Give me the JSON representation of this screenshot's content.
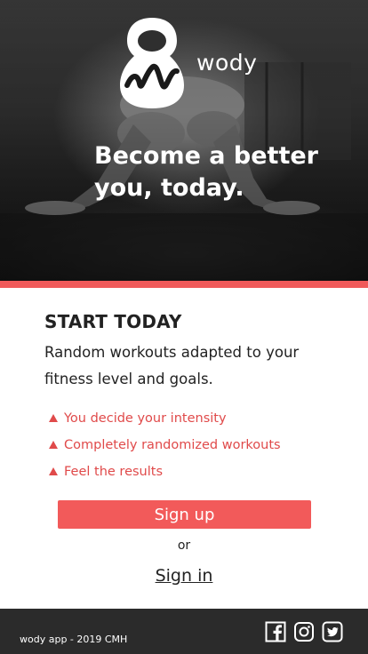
{
  "hero": {
    "brand_name": "wody",
    "tagline": "Become a better you, today."
  },
  "main": {
    "section_title": "START TODAY",
    "description": "Random workouts adapted to your fitness level and goals.",
    "features": [
      "You decide your intensity",
      "Completely randomized workouts",
      "Feel the results"
    ],
    "signup_label": "Sign up",
    "or_label": "or",
    "signin_label": "Sign in"
  },
  "footer": {
    "copyright": "wody app - 2019 CMH",
    "social": [
      "facebook-icon",
      "instagram-icon",
      "twitter-icon"
    ]
  },
  "colors": {
    "accent": "#f05a5a",
    "feature_text": "#e04a4a",
    "footer_bg": "#2b2b2b",
    "hero_text": "#ffffff"
  }
}
